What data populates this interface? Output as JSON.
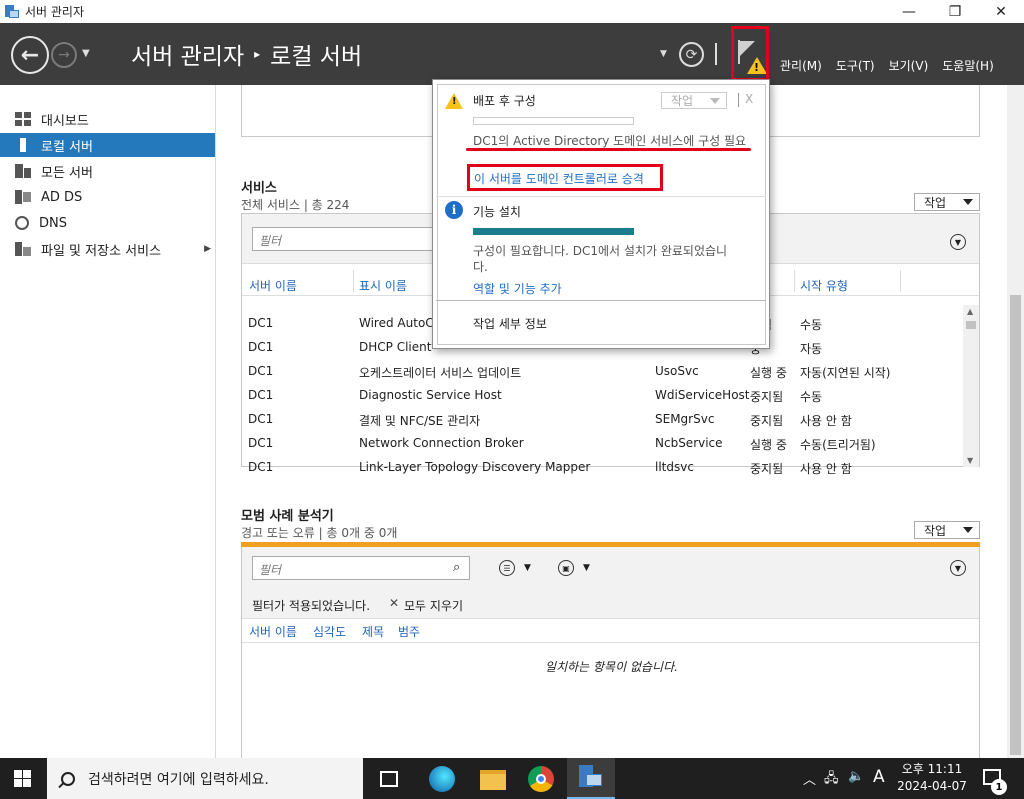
{
  "window": {
    "title": "서버 관리자",
    "minimize": "—",
    "restore": "❐",
    "close": "✕"
  },
  "header": {
    "breadcrumb_root": "서버 관리자",
    "breadcrumb_sep": "▸",
    "breadcrumb_current": "로컬 서버",
    "menus": [
      "관리(M)",
      "도구(T)",
      "보기(V)",
      "도움말(H)"
    ]
  },
  "sidebar": {
    "items": [
      {
        "label": "대시보드",
        "icon": "dashboard-icon"
      },
      {
        "label": "로컬 서버",
        "icon": "local-server-icon",
        "active": true
      },
      {
        "label": "모든 서버",
        "icon": "all-servers-icon"
      },
      {
        "label": "AD DS",
        "icon": "ad-ds-icon"
      },
      {
        "label": "DNS",
        "icon": "dns-icon"
      },
      {
        "label": "파일 및 저장소 서비스",
        "icon": "file-storage-icon",
        "has_submenu": true
      }
    ]
  },
  "services": {
    "title": "서비스",
    "subtitle": "전체 서비스 | 총 224",
    "task_label": "작업",
    "filter_placeholder": "필터",
    "columns": [
      "서버 이름",
      "표시 이름",
      "시작 유형"
    ],
    "rows": [
      {
        "server": "DC1",
        "display": "Wired AutoCo",
        "service": "",
        "status": "지됨",
        "startup": "수동"
      },
      {
        "server": "DC1",
        "display": "DHCP Client",
        "service": "",
        "status": "중",
        "startup": "자동"
      },
      {
        "server": "DC1",
        "display": "오케스트레이터 서비스 업데이트",
        "service": "UsoSvc",
        "status": "실행 중",
        "startup": "자동(지연된 시작)"
      },
      {
        "server": "DC1",
        "display": "Diagnostic Service Host",
        "service": "WdiServiceHost",
        "status": "중지됨",
        "startup": "수동"
      },
      {
        "server": "DC1",
        "display": "결제 및 NFC/SE 관리자",
        "service": "SEMgrSvc",
        "status": "중지됨",
        "startup": "사용 안 함"
      },
      {
        "server": "DC1",
        "display": "Network Connection Broker",
        "service": "NcbService",
        "status": "실행 중",
        "startup": "수동(트리거됨)"
      },
      {
        "server": "DC1",
        "display": "Link-Layer Topology Discovery Mapper",
        "service": "lltdsvc",
        "status": "중지됨",
        "startup": "사용 안 함"
      }
    ]
  },
  "bpa": {
    "title": "모범 사례 분석기",
    "subtitle": "경고 또는 오류 | 총 0개 중 0개",
    "task_label": "작업",
    "filter_placeholder": "필터",
    "filter_applied": "필터가 적용되었습니다.",
    "clear_all": "모두 지우기",
    "columns": [
      "서버 이름",
      "심각도",
      "제목",
      "범주"
    ],
    "empty_message": "일치하는 항목이 없습니다."
  },
  "popup": {
    "post_deploy_title": "배포 후 구성",
    "task_label": "작업",
    "close": "X",
    "post_deploy_message": "DC1의 Active Directory 도메인 서비스에 구성 필요",
    "promote_link": "이 서버를 도메인 컨트롤러로 승격",
    "feature_title": "기능 설치",
    "feature_message_1": "구성이 필요합니다. DC1에서 설치가 완료되었습니",
    "feature_message_2": "다.",
    "add_roles_link": "역할 및 기능 추가",
    "task_details": "작업 세부 정보",
    "feature_progress": 1.0
  },
  "taskbar": {
    "search_placeholder": "검색하려면 여기에 입력하세요.",
    "ime": "A",
    "time": "오후 11:11",
    "date": "2024-04-07",
    "notification_count": "1"
  }
}
